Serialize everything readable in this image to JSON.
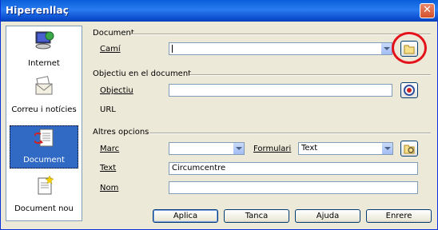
{
  "window": {
    "title": "Hiperenllaç"
  },
  "sidebar": {
    "items": [
      {
        "label": "Internet",
        "icon": "internet-icon",
        "selected": false
      },
      {
        "label": "Correu i notícies",
        "icon": "mail-icon",
        "selected": false
      },
      {
        "label": "Document",
        "icon": "document-icon",
        "selected": true
      },
      {
        "label": "Document nou",
        "icon": "new-document-icon",
        "selected": false
      }
    ]
  },
  "document_group": {
    "title": "Document",
    "path_label": "Camí",
    "path_value": ""
  },
  "target_group": {
    "title": "Objectiu en el document",
    "target_label": "Objectiu",
    "target_value": "",
    "url_label": "URL"
  },
  "other_group": {
    "title": "Altres opcions",
    "frame_label": "Marc",
    "frame_value": "",
    "form_label": "Formulari",
    "form_value": "Text",
    "text_label": "Text",
    "text_value": "Circumcentre",
    "name_label": "Nom",
    "name_value": ""
  },
  "buttons": {
    "apply": "Aplica",
    "close": "Tanca",
    "help": "Ajuda",
    "back": "Enrere"
  },
  "colors": {
    "title_bar": "#0a5fd8",
    "highlight_circle": "#e3121b",
    "selection": "#316ac5"
  }
}
